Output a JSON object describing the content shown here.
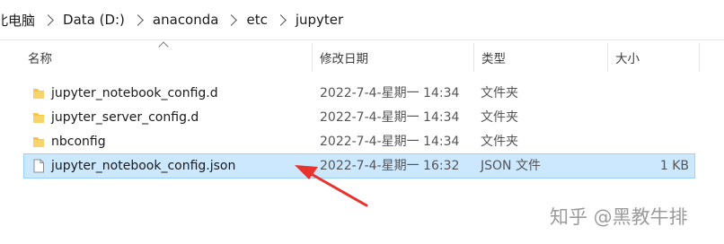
{
  "breadcrumb": [
    "北电脑",
    "Data (D:)",
    "anaconda",
    "etc",
    "jupyter"
  ],
  "columns": {
    "name": "名称",
    "date": "修改日期",
    "type": "类型",
    "size": "大小"
  },
  "files": [
    {
      "name": "jupyter_notebook_config.d",
      "date": "2022-7-4-星期一 14:34",
      "type": "文件夹",
      "size": "",
      "icon": "folder-icon",
      "selected": false
    },
    {
      "name": "jupyter_server_config.d",
      "date": "2022-7-4-星期一 14:34",
      "type": "文件夹",
      "size": "",
      "icon": "folder-icon",
      "selected": false
    },
    {
      "name": "nbconfig",
      "date": "2022-7-4-星期一 14:34",
      "type": "文件夹",
      "size": "",
      "icon": "folder-icon",
      "selected": false
    },
    {
      "name": "jupyter_notebook_config.json",
      "date": "2022-7-4-星期一 16:32",
      "type": "JSON 文件",
      "size": "1 KB",
      "icon": "file-icon",
      "selected": true
    }
  ],
  "watermark": "知乎 @黑教牛排",
  "colors": {
    "selection": "#cce8ff",
    "folder": "#f5c643",
    "annotation_arrow": "#e8322b"
  }
}
